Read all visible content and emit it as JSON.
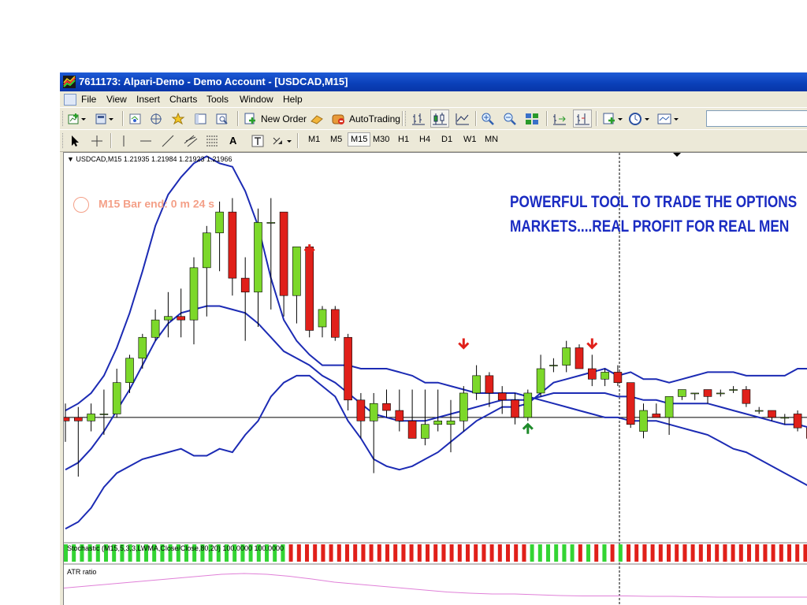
{
  "window": {
    "title": "7611173: Alpari-Demo - Demo Account - [USDCAD,M15]"
  },
  "menu": [
    "File",
    "View",
    "Insert",
    "Charts",
    "Tools",
    "Window",
    "Help"
  ],
  "toolbar1": {
    "new_order": "New Order",
    "autotrading": "AutoTrading"
  },
  "toolbar2": {
    "text_tool": "A",
    "timeframes": [
      "M1",
      "M5",
      "M15",
      "M30",
      "H1",
      "H4",
      "D1",
      "W1",
      "MN"
    ],
    "active_timeframe": "M15"
  },
  "chart": {
    "header": "USDCAD,M15  1.21935 1.21984 1.21923 1.21966",
    "timer": "M15 Bar end: 0 m 24 s",
    "headline": [
      "POWERFUL TOOL TO TRADE THE OPTIONS",
      "MARKETS....REAL PROFIT FOR REAL MEN"
    ],
    "stochastic_label": "Stochastic (M15,5,3,3,LWMA,Close/Close,80,20) 100.0000 100.0000",
    "atr_label": "ATR ratio",
    "colors": {
      "bull": "#7cd82a",
      "bear": "#e0201a",
      "bands": "#1c2bb4",
      "signal_down": "#e0201a",
      "signal_up": "#1e8a2a",
      "atr_line": "#e080d8",
      "headline": "#1a2bc2"
    }
  },
  "chart_data": {
    "type": "candlestick",
    "symbol": "USDCAD",
    "timeframe": "M15",
    "candles": [
      {
        "o": 1.214,
        "h": 1.2144,
        "c": 1.2139,
        "l": 1.2133
      },
      {
        "o": 1.214,
        "h": 1.2143,
        "c": 1.2139,
        "l": 1.2123
      },
      {
        "o": 1.2139,
        "h": 1.2144,
        "c": 1.2141,
        "l": 1.2136
      },
      {
        "o": 1.2141,
        "h": 1.2148,
        "c": 1.2141,
        "l": 1.2135
      },
      {
        "o": 1.2141,
        "h": 1.2154,
        "c": 1.215,
        "l": 1.214
      },
      {
        "o": 1.215,
        "h": 1.2158,
        "c": 1.2157,
        "l": 1.2147
      },
      {
        "o": 1.2157,
        "h": 1.2164,
        "c": 1.2163,
        "l": 1.2154
      },
      {
        "o": 1.2163,
        "h": 1.2171,
        "c": 1.2168,
        "l": 1.2162
      },
      {
        "o": 1.2168,
        "h": 1.2176,
        "c": 1.2169,
        "l": 1.2163
      },
      {
        "o": 1.2169,
        "h": 1.2177,
        "c": 1.2168,
        "l": 1.2163
      },
      {
        "o": 1.2168,
        "h": 1.2186,
        "c": 1.2183,
        "l": 1.2161
      },
      {
        "o": 1.2183,
        "h": 1.2195,
        "c": 1.2193,
        "l": 1.2169
      },
      {
        "o": 1.2193,
        "h": 1.2202,
        "c": 1.2199,
        "l": 1.2182
      },
      {
        "o": 1.2199,
        "h": 1.2203,
        "c": 1.218,
        "l": 1.2175
      },
      {
        "o": 1.218,
        "h": 1.2186,
        "c": 1.2176,
        "l": 1.2162
      },
      {
        "o": 1.2176,
        "h": 1.22,
        "c": 1.2196,
        "l": 1.2166
      },
      {
        "o": 1.2196,
        "h": 1.2203,
        "c": 1.2196,
        "l": 1.2171
      },
      {
        "o": 1.2199,
        "h": 1.2199,
        "c": 1.2175,
        "l": 1.2169
      },
      {
        "o": 1.2175,
        "h": 1.2189,
        "c": 1.2189,
        "l": 1.2167
      },
      {
        "o": 1.2189,
        "h": 1.2189,
        "c": 1.2165,
        "l": 1.2163
      },
      {
        "o": 1.2166,
        "h": 1.2172,
        "c": 1.2171,
        "l": 1.2163
      },
      {
        "o": 1.2171,
        "h": 1.2172,
        "c": 1.2163,
        "l": 1.2162
      },
      {
        "o": 1.2163,
        "h": 1.2164,
        "c": 1.2145,
        "l": 1.2142
      },
      {
        "o": 1.2145,
        "h": 1.2147,
        "c": 1.2139,
        "l": 1.2134
      },
      {
        "o": 1.2139,
        "h": 1.2147,
        "c": 1.2144,
        "l": 1.2124
      },
      {
        "o": 1.2144,
        "h": 1.2148,
        "c": 1.2142,
        "l": 1.214
      },
      {
        "o": 1.2142,
        "h": 1.2148,
        "c": 1.2139,
        "l": 1.2136
      },
      {
        "o": 1.2139,
        "h": 1.2148,
        "c": 1.2134,
        "l": 1.2134
      },
      {
        "o": 1.2134,
        "h": 1.2148,
        "c": 1.2138,
        "l": 1.2132
      },
      {
        "o": 1.2138,
        "h": 1.2148,
        "c": 1.2139,
        "l": 1.2136
      },
      {
        "o": 1.2138,
        "h": 1.2145,
        "c": 1.2139,
        "l": 1.213
      },
      {
        "o": 1.2139,
        "h": 1.2149,
        "c": 1.2147,
        "l": 1.2136
      },
      {
        "o": 1.2147,
        "h": 1.2155,
        "c": 1.2152,
        "l": 1.2145
      },
      {
        "o": 1.2152,
        "h": 1.2153,
        "c": 1.2147,
        "l": 1.2143
      },
      {
        "o": 1.2147,
        "h": 1.2149,
        "c": 1.2145,
        "l": 1.2141
      },
      {
        "o": 1.2145,
        "h": 1.2147,
        "c": 1.214,
        "l": 1.2138
      },
      {
        "o": 1.214,
        "h": 1.2148,
        "c": 1.2147,
        "l": 1.2139
      },
      {
        "o": 1.2147,
        "h": 1.2158,
        "c": 1.2154,
        "l": 1.2146
      },
      {
        "o": 1.2155,
        "h": 1.2157,
        "c": 1.2155,
        "l": 1.2153
      },
      {
        "o": 1.2155,
        "h": 1.2162,
        "c": 1.216,
        "l": 1.2153
      },
      {
        "o": 1.216,
        "h": 1.2161,
        "c": 1.2154,
        "l": 1.2154
      },
      {
        "o": 1.2154,
        "h": 1.2158,
        "c": 1.2151,
        "l": 1.2149
      },
      {
        "o": 1.2151,
        "h": 1.2154,
        "c": 1.2153,
        "l": 1.2149
      },
      {
        "o": 1.2153,
        "h": 1.2155,
        "c": 1.215,
        "l": 1.2149
      },
      {
        "o": 1.215,
        "h": 1.215,
        "c": 1.2138,
        "l": 1.2137
      },
      {
        "o": 1.2136,
        "h": 1.2144,
        "c": 1.2142,
        "l": 1.2134
      },
      {
        "o": 1.2141,
        "h": 1.2144,
        "c": 1.214,
        "l": 1.214
      },
      {
        "o": 1.214,
        "h": 1.2146,
        "c": 1.2146,
        "l": 1.2135
      },
      {
        "o": 1.2146,
        "h": 1.2148,
        "c": 1.2148,
        "l": 1.2145
      },
      {
        "o": 1.2147,
        "h": 1.2147,
        "c": 1.2147,
        "l": 1.2145
      },
      {
        "o": 1.2148,
        "h": 1.2148,
        "c": 1.2146,
        "l": 1.2144
      },
      {
        "o": 1.2147,
        "h": 1.2148,
        "c": 1.2147,
        "l": 1.2146
      },
      {
        "o": 1.2148,
        "h": 1.2149,
        "c": 1.2148,
        "l": 1.2147
      },
      {
        "o": 1.2148,
        "h": 1.2149,
        "c": 1.2144,
        "l": 1.2143
      },
      {
        "o": 1.2142,
        "h": 1.2143,
        "c": 1.2142,
        "l": 1.2141
      },
      {
        "o": 1.2142,
        "h": 1.2142,
        "c": 1.214,
        "l": 1.2139
      },
      {
        "o": 1.214,
        "h": 1.2141,
        "c": 1.214,
        "l": 1.2138
      },
      {
        "o": 1.2141,
        "h": 1.2142,
        "c": 1.2137,
        "l": 1.2136
      },
      {
        "o": 1.2137,
        "h": 1.2138,
        "c": 1.2134,
        "l": 1.2133
      },
      {
        "o": 1.2134,
        "h": 1.214,
        "c": 1.2131,
        "l": 1.213
      },
      {
        "o": 1.2131,
        "h": 1.2133,
        "c": 1.2129,
        "l": 1.2128
      }
    ],
    "bollinger_upper": [
      1.2142,
      1.2144,
      1.2147,
      1.2152,
      1.216,
      1.217,
      1.2182,
      1.2195,
      1.2204,
      1.2209,
      1.2213,
      1.2215,
      1.2213,
      1.2212,
      1.2205,
      1.2195,
      1.218,
      1.2168,
      1.2162,
      1.2158,
      1.2155,
      1.2155,
      1.2155,
      1.2154,
      1.2154,
      1.2154,
      1.2153,
      1.2152,
      1.215,
      1.215,
      1.2149,
      1.2148,
      1.2147,
      1.2147,
      1.2147,
      1.2147,
      1.2146,
      1.2145,
      1.2144,
      1.2143,
      1.2142,
      1.2141,
      1.214,
      1.214,
      1.2139,
      1.2139,
      1.2139,
      1.2138,
      1.2137,
      1.2136,
      1.2135,
      1.2133,
      1.2131,
      1.213,
      1.2128,
      1.2126,
      1.2124,
      1.2122,
      1.212,
      1.2118,
      1.2116,
      1.2114
    ],
    "bollinger_middle": [
      1.2125,
      1.2127,
      1.2131,
      1.2136,
      1.2142,
      1.2148,
      1.2155,
      1.2162,
      1.2167,
      1.217,
      1.2171,
      1.2172,
      1.2172,
      1.2171,
      1.217,
      1.2167,
      1.2163,
      1.2159,
      1.2157,
      1.2155,
      1.2152,
      1.215,
      1.2147,
      1.2144,
      1.2141,
      1.214,
      1.2139,
      1.2139,
      1.2139,
      1.214,
      1.2141,
      1.2142,
      1.2143,
      1.2144,
      1.2145,
      1.2145,
      1.2145,
      1.2146,
      1.2147,
      1.2147,
      1.2147,
      1.2147,
      1.2147,
      1.2146,
      1.2146,
      1.2145,
      1.2145,
      1.2144,
      1.2144,
      1.2144,
      1.2144,
      1.2143,
      1.2142,
      1.2141,
      1.214,
      1.2139,
      1.2138,
      1.2138,
      1.2137,
      1.2136,
      1.2135
    ],
    "bollinger_lower": [
      1.2108,
      1.211,
      1.2114,
      1.212,
      1.2124,
      1.2126,
      1.2128,
      1.2129,
      1.213,
      1.2131,
      1.2129,
      1.2129,
      1.2131,
      1.213,
      1.2135,
      1.2139,
      1.2146,
      1.215,
      1.2152,
      1.2152,
      1.2149,
      1.2146,
      1.2139,
      1.2134,
      1.2128,
      1.2126,
      1.2125,
      1.2126,
      1.2128,
      1.213,
      1.2133,
      1.2136,
      1.2139,
      1.2141,
      1.2143,
      1.2143,
      1.2144,
      1.2147,
      1.215,
      1.2151,
      1.2152,
      1.2153,
      1.2154,
      1.2152,
      1.2153,
      1.2151,
      1.2151,
      1.215,
      1.2151,
      1.2152,
      1.2153,
      1.2153,
      1.2153,
      1.2152,
      1.2152,
      1.2152,
      1.2152,
      1.2154,
      1.2154,
      1.2154,
      1.2155
    ],
    "horizontal_line": 1.214,
    "signals": [
      {
        "type": "down",
        "bar": 19,
        "price": 1.2187
      },
      {
        "type": "down",
        "bar": 31,
        "price": 1.216
      },
      {
        "type": "up",
        "bar": 36,
        "price": 1.2138
      },
      {
        "type": "down",
        "bar": 41,
        "price": 1.216
      }
    ],
    "stochastic_bars": "alternating green/white and red/white histogram",
    "atr_ratio": "pink line"
  }
}
